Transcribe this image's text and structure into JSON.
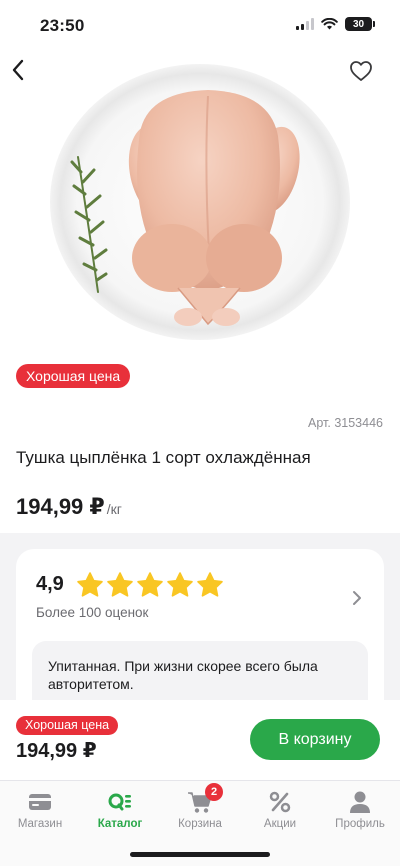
{
  "status_bar": {
    "time": "23:50",
    "battery": "30"
  },
  "nav": {
    "back_icon": "chevron-left-icon",
    "favorite_icon": "heart-icon"
  },
  "product": {
    "badge": "Хорошая цена",
    "article": "Арт. 3153446",
    "title": "Тушка цыплёнка 1 сорт охлаждённая",
    "price": "194,99 ₽",
    "unit": "/кг"
  },
  "rating": {
    "value": "4,9",
    "stars": 5,
    "count_text": "Более 100 оценок",
    "review_text": "Упитанная. При жизни скорее всего была авторитетом."
  },
  "buy_bar": {
    "badge": "Хорошая цена",
    "price": "194,99 ₽",
    "add_button": "В корзину"
  },
  "tabs": [
    {
      "label": "Магазин",
      "icon": "card-icon"
    },
    {
      "label": "Каталог",
      "icon": "catalog-icon",
      "active": true
    },
    {
      "label": "Корзина",
      "icon": "cart-icon",
      "badge": "2"
    },
    {
      "label": "Акции",
      "icon": "percent-icon"
    },
    {
      "label": "Профиль",
      "icon": "profile-icon"
    }
  ],
  "colors": {
    "accent_green": "#2aa84a",
    "badge_red": "#e8303a",
    "star_yellow": "#f9c623"
  }
}
